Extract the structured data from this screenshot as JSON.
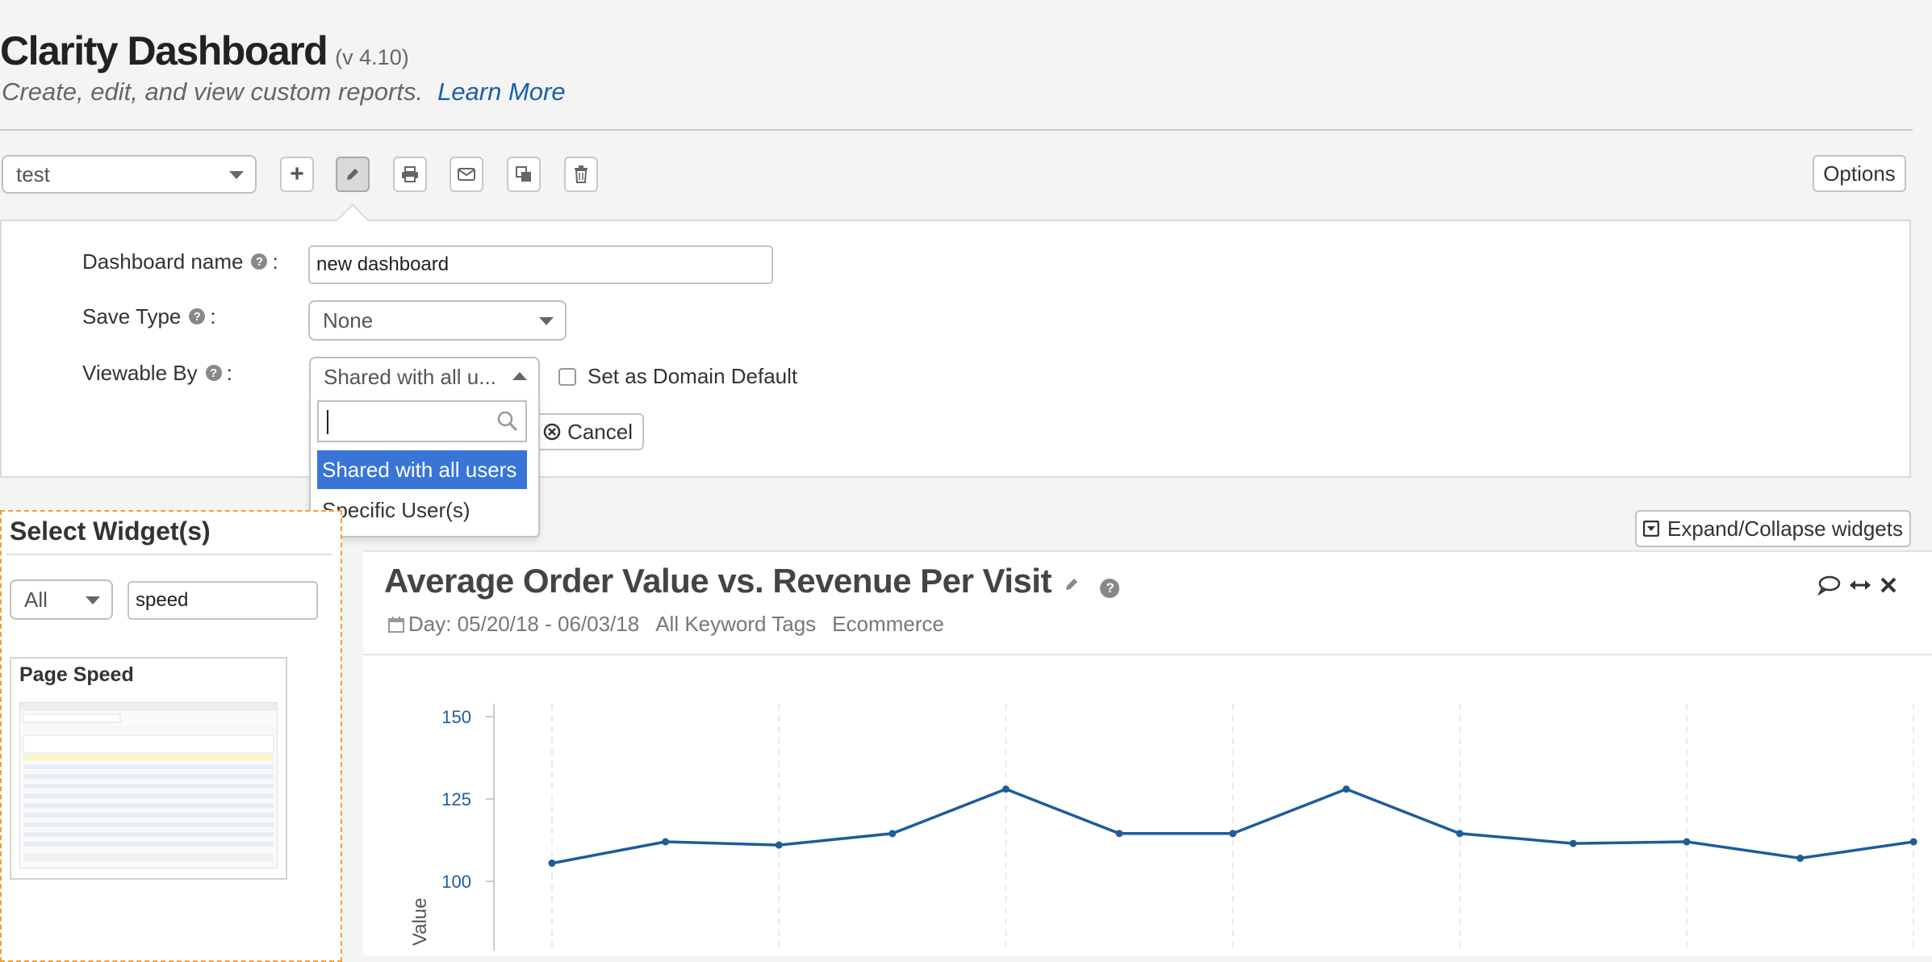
{
  "header": {
    "title": "Clarity Dashboard",
    "version": "(v 4.10)",
    "subtitle": "Create, edit, and view custom reports.",
    "learn_more": "Learn More"
  },
  "toolbar": {
    "dashboard_select": "test",
    "buttons": [
      {
        "name": "add",
        "icon": "plus-icon"
      },
      {
        "name": "edit",
        "icon": "pencil-icon",
        "active": true
      },
      {
        "name": "print",
        "icon": "print-icon"
      },
      {
        "name": "email",
        "icon": "envelope-icon"
      },
      {
        "name": "copy",
        "icon": "copy-icon"
      },
      {
        "name": "delete",
        "icon": "trash-icon"
      }
    ],
    "options_label": "Options"
  },
  "edit_panel": {
    "name_label": "Dashboard name",
    "name_value": "new dashboard",
    "save_type_label": "Save Type",
    "save_type_value": "None",
    "viewable_label": "Viewable By",
    "viewable_value": "Shared with all u...",
    "domain_default_label": "Set as Domain Default",
    "cancel_label": "Cancel",
    "dropdown": {
      "search_placeholder": "",
      "options": [
        "Shared with all users",
        "Specific User(s)"
      ],
      "selected_index": 0
    }
  },
  "widget_picker": {
    "title": "Select Widget(s)",
    "filter_value": "All",
    "search_value": "speed",
    "results": [
      {
        "title": "Page Speed"
      }
    ]
  },
  "expand_collapse_label": "Expand/Collapse widgets",
  "chart_widget": {
    "title": "Average Order Value vs. Revenue Per Visit",
    "date_range": "Day: 05/20/18 - 06/03/18",
    "tags": "All Keyword Tags",
    "category": "Ecommerce"
  },
  "colors": {
    "accent_blue": "#1a5fa8",
    "line": "#1f5c99",
    "selected": "#3875d7",
    "dashed_border": "#f0a030"
  },
  "chart_data": {
    "type": "line",
    "title": "",
    "ylabel": "Value",
    "xlabel": "",
    "y_ticks": [
      100,
      125,
      150
    ],
    "ylim": [
      88,
      160
    ],
    "grid": "vertical dashed",
    "series": [
      {
        "values": [
          105.5,
          112,
          111,
          114.5,
          128,
          114.5,
          114.5,
          128,
          114.5,
          111.5,
          112,
          107,
          112
        ]
      }
    ]
  }
}
